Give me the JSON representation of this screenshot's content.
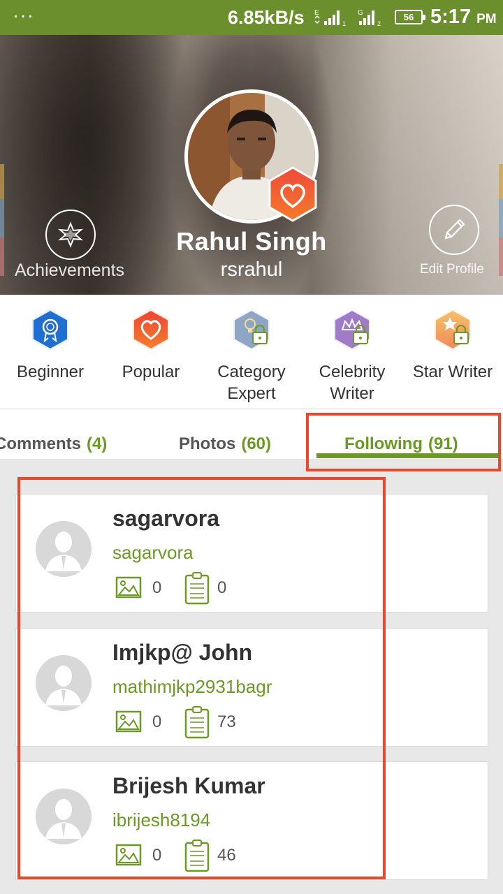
{
  "status_bar": {
    "dots": "···",
    "speed": "6.85kB/s",
    "sim1_label": "E",
    "sim2_label": "G",
    "battery": "56",
    "time": "5:17",
    "ampm": "PM"
  },
  "header": {
    "achievements_label": "Achievements",
    "edit_profile_label": "Edit  Profile",
    "name": "Rahul Singh",
    "username": "rsrahul"
  },
  "badges": [
    {
      "label_line1": "Beginner",
      "label_line2": "",
      "color": "#1f6fd1",
      "icon": "ribbon-icon",
      "locked": false
    },
    {
      "label_line1": "Popular",
      "label_line2": "",
      "color": "#ee5533",
      "icon": "heart-icon",
      "locked": false
    },
    {
      "label_line1": "Category",
      "label_line2": "Expert",
      "color": "#8a9ec0",
      "icon": "bulb-icon",
      "locked": true
    },
    {
      "label_line1": "Celebrity",
      "label_line2": "Writer",
      "color": "#9b7bc4",
      "icon": "crown-icon",
      "locked": true
    },
    {
      "label_line1": "Star Writer",
      "label_line2": "",
      "color": "#f0a060",
      "icon": "star-icon",
      "locked": true
    }
  ],
  "tabs": [
    {
      "label": "Comments",
      "count": "(4)"
    },
    {
      "label": "Photos",
      "count": "(60)"
    },
    {
      "label": "Following",
      "count": "(91)",
      "active": true
    }
  ],
  "following": [
    {
      "name": "sagarvora",
      "handle": "sagarvora",
      "photos": "0",
      "articles": "0"
    },
    {
      "name": "Imjkp@ John",
      "handle": "mathimjkp2931bagr",
      "photos": "0",
      "articles": "73"
    },
    {
      "name": "Brijesh Kumar",
      "handle": "ibrijesh8194",
      "photos": "0",
      "articles": "46"
    }
  ],
  "colors": {
    "brand_green": "#6a9a24",
    "status_bar": "#6a8f2c",
    "highlight_red": "#e8492c"
  }
}
